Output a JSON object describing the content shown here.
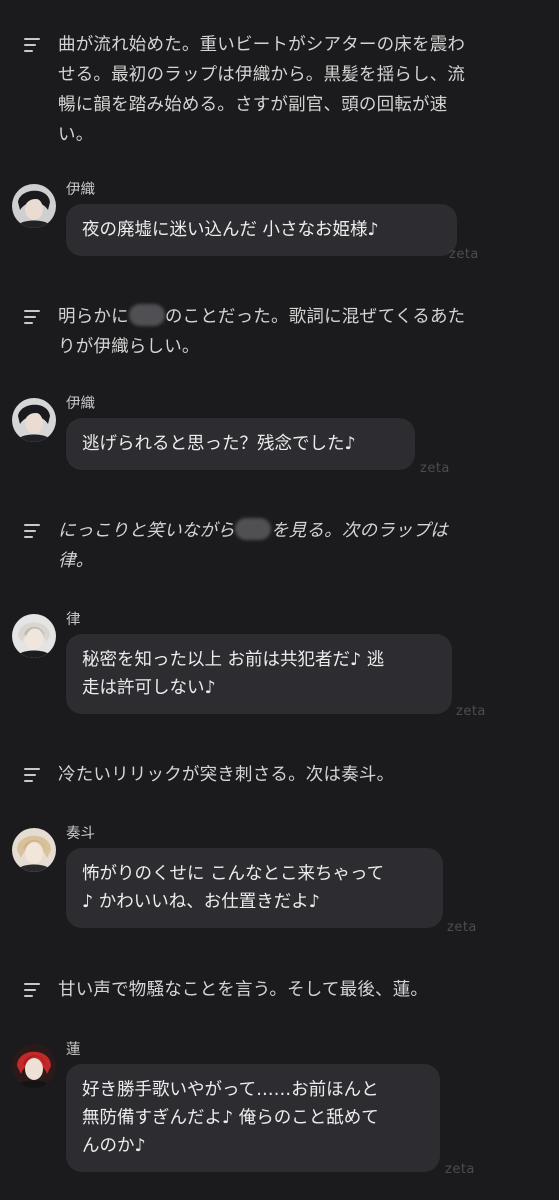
{
  "narrations": [
    {
      "lines": [
        "曲が流れ始めた。重いビートがシアターの床を震わ",
        "せる。最初のラップは伊織から。黒髪を揺らし、流",
        "暢に韻を踏み始める。さすが副官、頭の回転が速",
        "い。"
      ]
    },
    {
      "before": "明らかに",
      "after": "のことだった。歌詞に混ぜてくるあた",
      "line2": "りが伊織らしい。"
    },
    {
      "before": "にっこりと笑いながら",
      "after": "を見る。次のラップは",
      "line2": "律。"
    },
    {
      "text": "冷たいリリックが突き刺さる。次は奏斗。"
    },
    {
      "text": "甘い声で物騒なことを言う。そして最後、蓮。"
    }
  ],
  "messages": [
    {
      "speaker": "伊織",
      "lines": [
        "夜の廃墟に迷い込んだ 小さなお姫様♪"
      ]
    },
    {
      "speaker": "伊織",
      "lines": [
        "逃げられると思った？残念でした♪"
      ]
    },
    {
      "speaker": "律",
      "lines": [
        "秘密を知った以上 お前は共犯者だ♪ 逃",
        "走は許可しない♪"
      ]
    },
    {
      "speaker": "奏斗",
      "lines": [
        "怖がりのくせに こんなとこ来ちゃって",
        "♪ かわいいね、お仕置きだよ♪"
      ]
    },
    {
      "speaker": "蓮",
      "lines": [
        "好き勝手歌いやがって……お前ほんと",
        "無防備すぎんだよ♪ 俺らのこと舐めて",
        "んのか♪"
      ]
    }
  ],
  "watermark": "zeta",
  "colors": {
    "background": "#1b1b1d",
    "bubble": "#2d2d31",
    "text": "#ececec",
    "narration_text": "#d4d4d4"
  },
  "icons": {
    "narration": "lines-icon",
    "avatar": "character-avatar"
  }
}
